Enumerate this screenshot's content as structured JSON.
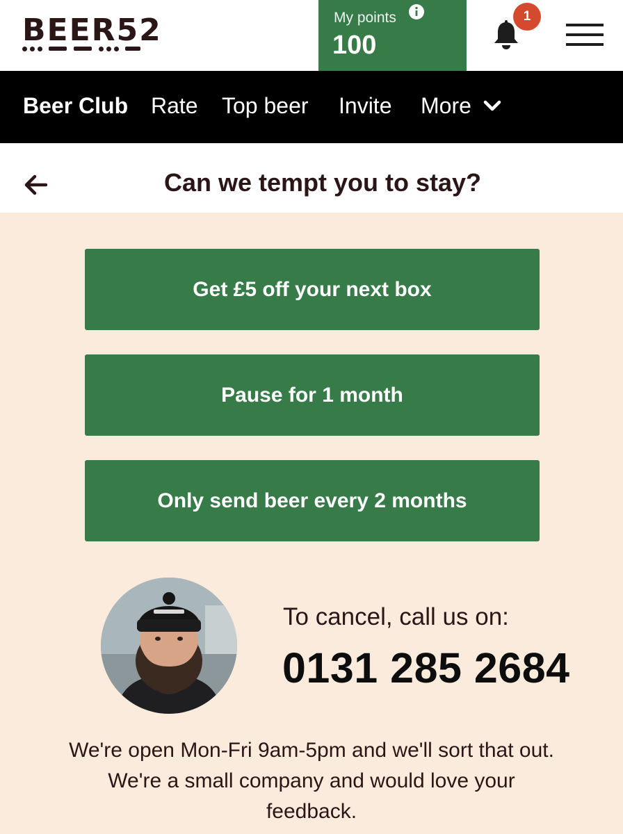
{
  "header": {
    "logo_text": "BEER52",
    "points_label": "My points",
    "points_value": "100",
    "notification_count": "1"
  },
  "nav": {
    "items": [
      "Beer Club",
      "Rate",
      "Top beer",
      "Invite",
      "More"
    ]
  },
  "page": {
    "title": "Can we tempt you to stay?"
  },
  "options": [
    "Get £5 off your next box",
    "Pause for 1 month",
    "Only send beer every 2 months"
  ],
  "contact": {
    "cancel_label": "To cancel, call us on:",
    "phone": "0131 285 2684",
    "hours_text": "We're open Mon-Fri 9am-5pm and we'll sort that out. We're a small company and would love your feedback."
  },
  "colors": {
    "brand_green": "#367b48",
    "background": "#fbebdc",
    "badge_red": "#d44a2e",
    "nav_black": "#000000"
  },
  "icons": [
    "info-icon",
    "bell-icon",
    "hamburger-menu-icon",
    "chevron-down-icon",
    "back-arrow-icon"
  ]
}
